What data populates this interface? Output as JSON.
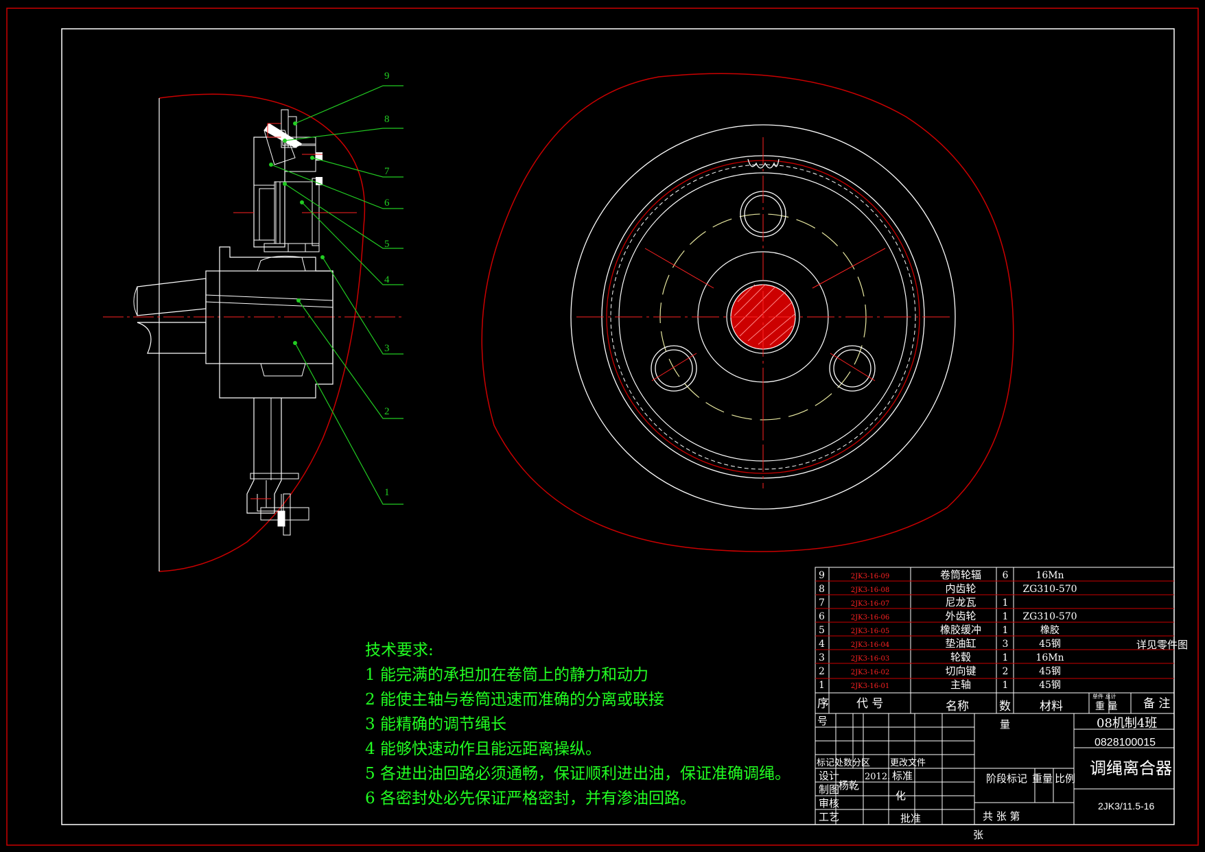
{
  "colors": {
    "background": "#000000",
    "frame_red": "#cc0000",
    "lines_white": "#ffffff",
    "leaders_green": "#22cc22",
    "center_red": "#ff2222",
    "text_green": "#22ff22",
    "dashed_yellow": "#e8e8a0"
  },
  "balloons": [
    "9",
    "8",
    "7",
    "6",
    "5",
    "4",
    "3",
    "2",
    "1"
  ],
  "tech_requirements": {
    "title": "技术要求:",
    "items": [
      "1 能完满的承担加在卷筒上的静力和动力",
      "2 能使主轴与卷筒迅速而准确的分离或联接",
      "3 能精确的调节绳长",
      "4 能够快速动作且能远距离操纵。",
      "5 各进出油回路必须通畅，保证顺利进出油，保证准确调绳。",
      "6 各密封处必先保证严格密封，并有渗油回路。"
    ]
  },
  "parts_list": {
    "rows": [
      {
        "no": "9",
        "code": "2JK3-16-09",
        "name": "卷筒轮辐",
        "qty": "6",
        "material": "16Mn"
      },
      {
        "no": "8",
        "code": "2JK3-16-08",
        "name": "内齿轮",
        "qty": "",
        "material": "ZG310-570"
      },
      {
        "no": "7",
        "code": "2JK3-16-07",
        "name": "尼龙瓦",
        "qty": "1",
        "material": ""
      },
      {
        "no": "6",
        "code": "2JK3-16-06",
        "name": "外齿轮",
        "qty": "1",
        "material": "ZG310-570"
      },
      {
        "no": "5",
        "code": "2JK3-16-05",
        "name": "橡胶缓冲",
        "qty": "1",
        "material": "橡胶"
      },
      {
        "no": "4",
        "code": "2JK3-16-04",
        "name": "垫油缸",
        "qty": "3",
        "material": "45钢"
      },
      {
        "no": "3",
        "code": "2JK3-16-03",
        "name": "轮毂",
        "qty": "1",
        "material": "16Mn"
      },
      {
        "no": "2",
        "code": "2JK3-16-02",
        "name": "切向键",
        "qty": "2",
        "material": "45钢"
      },
      {
        "no": "1",
        "code": "2JK3-16-01",
        "name": "主轴",
        "qty": "1",
        "material": "45钢"
      }
    ],
    "remark": "详见零件图",
    "header": {
      "no": "序",
      "code": "代  号",
      "name": "名称",
      "qty": "数",
      "material": "材料",
      "weight": "重 量",
      "weight_small": "单件 总计",
      "note": "备 注",
      "no2": "号",
      "qty2": "量"
    }
  },
  "title_block": {
    "class_name": "08机制4班",
    "student_id": "0828100015",
    "drawing_title": "调绳离合器",
    "drawing_code": "2JK3/11.5-16",
    "rev_labels": "标记处数分区",
    "change_doc": "更改文件",
    "design": "设计",
    "signature": "杨乾",
    "year": "2012.",
    "standard": "标准",
    "standardize": "化",
    "drafting": "制图",
    "review": "审核",
    "process": "工艺",
    "approve": "批准",
    "stage": "阶段标记",
    "weight": "重量",
    "scale": "比例",
    "sheets": "共    张    第",
    "sheet_word": "张"
  }
}
